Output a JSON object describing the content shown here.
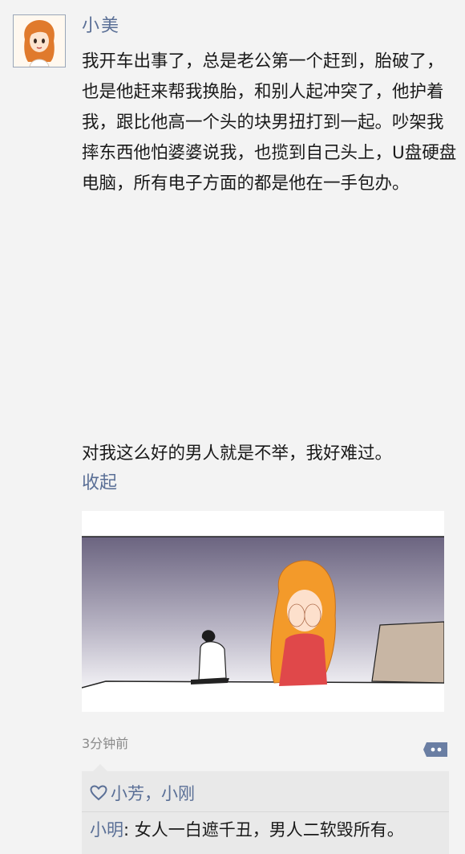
{
  "post": {
    "author": "小美",
    "text_main": "我开车出事了，总是老公第一个赶到，胎破了，也是他赶来帮我换胎，和别人起冲突了，他护着我，跟比他高一个头的块男扭打到一起。吵架我摔东西他怕婆婆说我，也揽到自己头上，U盘硬盘电脑，所有电子方面的都是他在一手包办。",
    "text_end": "对我这么好的男人就是不举，我好难过。",
    "collapse_label": "收起",
    "timestamp": "3分钟前"
  },
  "icons": {
    "avatar": "avatar-girl-orange-hair",
    "comment": "comment-bubble-icon",
    "like": "heart-icon"
  },
  "feedback": {
    "likes": [
      "小芳",
      "小刚"
    ],
    "like_separator": "，",
    "comments": [
      {
        "author": "小明",
        "colon": ":",
        "text": "女人一白遮千丑，男人二软毁所有。"
      }
    ]
  },
  "colors": {
    "link": "#5a6f96",
    "text": "#1a1a1a",
    "muted": "#8a8a8a",
    "background": "#f3f3f3",
    "feedback_bg": "#e9e9e9"
  }
}
